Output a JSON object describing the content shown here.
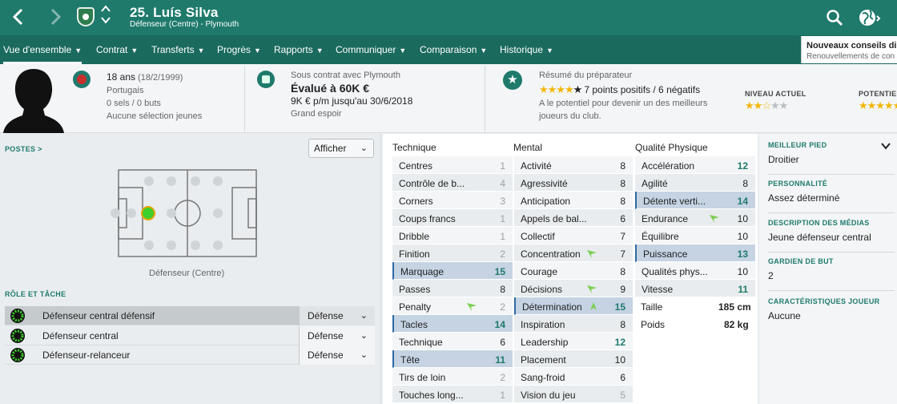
{
  "header": {
    "player_name": "25. Luís Silva",
    "player_subtitle": "Défenseur (Centre) - Plymouth",
    "back_icon": "chevron-left-icon",
    "forward_icon": "chevron-right-icon",
    "search_icon": "search-icon",
    "globe_icon": "globe-icon"
  },
  "menu": {
    "items": [
      {
        "label": "Vue d'ensemble",
        "active": true
      },
      {
        "label": "Contrat"
      },
      {
        "label": "Transferts"
      },
      {
        "label": "Progrès"
      },
      {
        "label": "Rapports"
      },
      {
        "label": "Communiquer"
      },
      {
        "label": "Comparaison"
      },
      {
        "label": "Historique"
      }
    ]
  },
  "advice": {
    "title": "Nouveaux conseils disp",
    "subtitle": "Renouvellements de con"
  },
  "personal": {
    "age": "18 ans",
    "birthdate": "(18/2/1999)",
    "nationality": "Portugais",
    "caps": "0 sels / 0 buts",
    "youth": "Aucune sélection jeunes"
  },
  "contract": {
    "status": "Sous contrat avec Plymouth",
    "value": "Évalué à 60K €",
    "wage": "9K € p/m jusqu'au 30/6/2018",
    "tag": "Grand espoir"
  },
  "report": {
    "title": "Résumé du préparateur",
    "points": "7 points positifs / 6 négatifs",
    "text1": "A le potentiel pour devenir un des meilleurs",
    "text2": "joueurs du club.",
    "current_label": "NIVEAU ACTUEL",
    "potential_label": "POTENTIEL",
    "star_color": "#f2b705"
  },
  "positions": {
    "title": "POSTES >",
    "show_button": "Afficher",
    "position_label": "Défenseur (Centre)"
  },
  "roles": {
    "title": "RÔLE ET TÂCHE",
    "rows": [
      {
        "name": "Défenseur central défensif",
        "duty": "Défense",
        "selected": true
      },
      {
        "name": "Défenseur central",
        "duty": "Défense"
      },
      {
        "name": "Défenseur-relanceur",
        "duty": "Défense"
      }
    ]
  },
  "attributes": {
    "technique_title": "Technique",
    "mental_title": "Mental",
    "physical_title": "Qualité Physique",
    "technique": [
      {
        "name": "Centres",
        "value": "1"
      },
      {
        "name": "Contrôle de b...",
        "value": "4"
      },
      {
        "name": "Corners",
        "value": "3"
      },
      {
        "name": "Coups francs",
        "value": "1"
      },
      {
        "name": "Dribble",
        "value": "1"
      },
      {
        "name": "Finition",
        "value": "2"
      },
      {
        "name": "Marquage",
        "value": "15",
        "hl": true
      },
      {
        "name": "Passes",
        "value": "8"
      },
      {
        "name": "Penalty",
        "value": "2",
        "arrow": "down"
      },
      {
        "name": "Tacles",
        "value": "14",
        "hl": true
      },
      {
        "name": "Technique",
        "value": "6"
      },
      {
        "name": "Tête",
        "value": "11",
        "hl": true
      },
      {
        "name": "Tirs de loin",
        "value": "2"
      },
      {
        "name": "Touches long...",
        "value": "1"
      }
    ],
    "mental": [
      {
        "name": "Activité",
        "value": "8"
      },
      {
        "name": "Agressivité",
        "value": "8"
      },
      {
        "name": "Anticipation",
        "value": "8"
      },
      {
        "name": "Appels de bal...",
        "value": "6"
      },
      {
        "name": "Collectif",
        "value": "7"
      },
      {
        "name": "Concentration",
        "value": "7",
        "arrow": "down"
      },
      {
        "name": "Courage",
        "value": "8"
      },
      {
        "name": "Décisions",
        "value": "9",
        "arrow": "down"
      },
      {
        "name": "Détermination",
        "value": "15",
        "hl": true,
        "arrow": "up"
      },
      {
        "name": "Inspiration",
        "value": "8"
      },
      {
        "name": "Leadership",
        "value": "12"
      },
      {
        "name": "Placement",
        "value": "10"
      },
      {
        "name": "Sang-froid",
        "value": "6"
      },
      {
        "name": "Vision du jeu",
        "value": "5"
      }
    ],
    "physical": [
      {
        "name": "Accélération",
        "value": "12"
      },
      {
        "name": "Agilité",
        "value": "8"
      },
      {
        "name": "Détente verti...",
        "value": "14",
        "hl": true
      },
      {
        "name": "Endurance",
        "value": "10",
        "arrow": "down"
      },
      {
        "name": "Équilibre",
        "value": "10"
      },
      {
        "name": "Puissance",
        "value": "13",
        "hl": true
      },
      {
        "name": "Qualités phys...",
        "value": "10"
      },
      {
        "name": "Vitesse",
        "value": "11"
      }
    ],
    "height_label": "Taille",
    "height_value": "185 cm",
    "weight_label": "Poids",
    "weight_value": "82 kg",
    "highlight_color": "#c5d3e3",
    "high_color": "#1f7a6c",
    "arrow_color": "#7ccf52"
  },
  "side_info": [
    {
      "title": "MEILLEUR PIED",
      "value": "Droitier"
    },
    {
      "title": "PERSONNALITÉ",
      "value": "Assez déterminé"
    },
    {
      "title": "DESCRIPTION DES MÉDIAS",
      "value": "Jeune défenseur central"
    },
    {
      "title": "GARDIEN DE BUT",
      "value": "2"
    },
    {
      "title": "CARACTÉRISTIQUES JOUEUR",
      "value": "Aucune"
    }
  ]
}
